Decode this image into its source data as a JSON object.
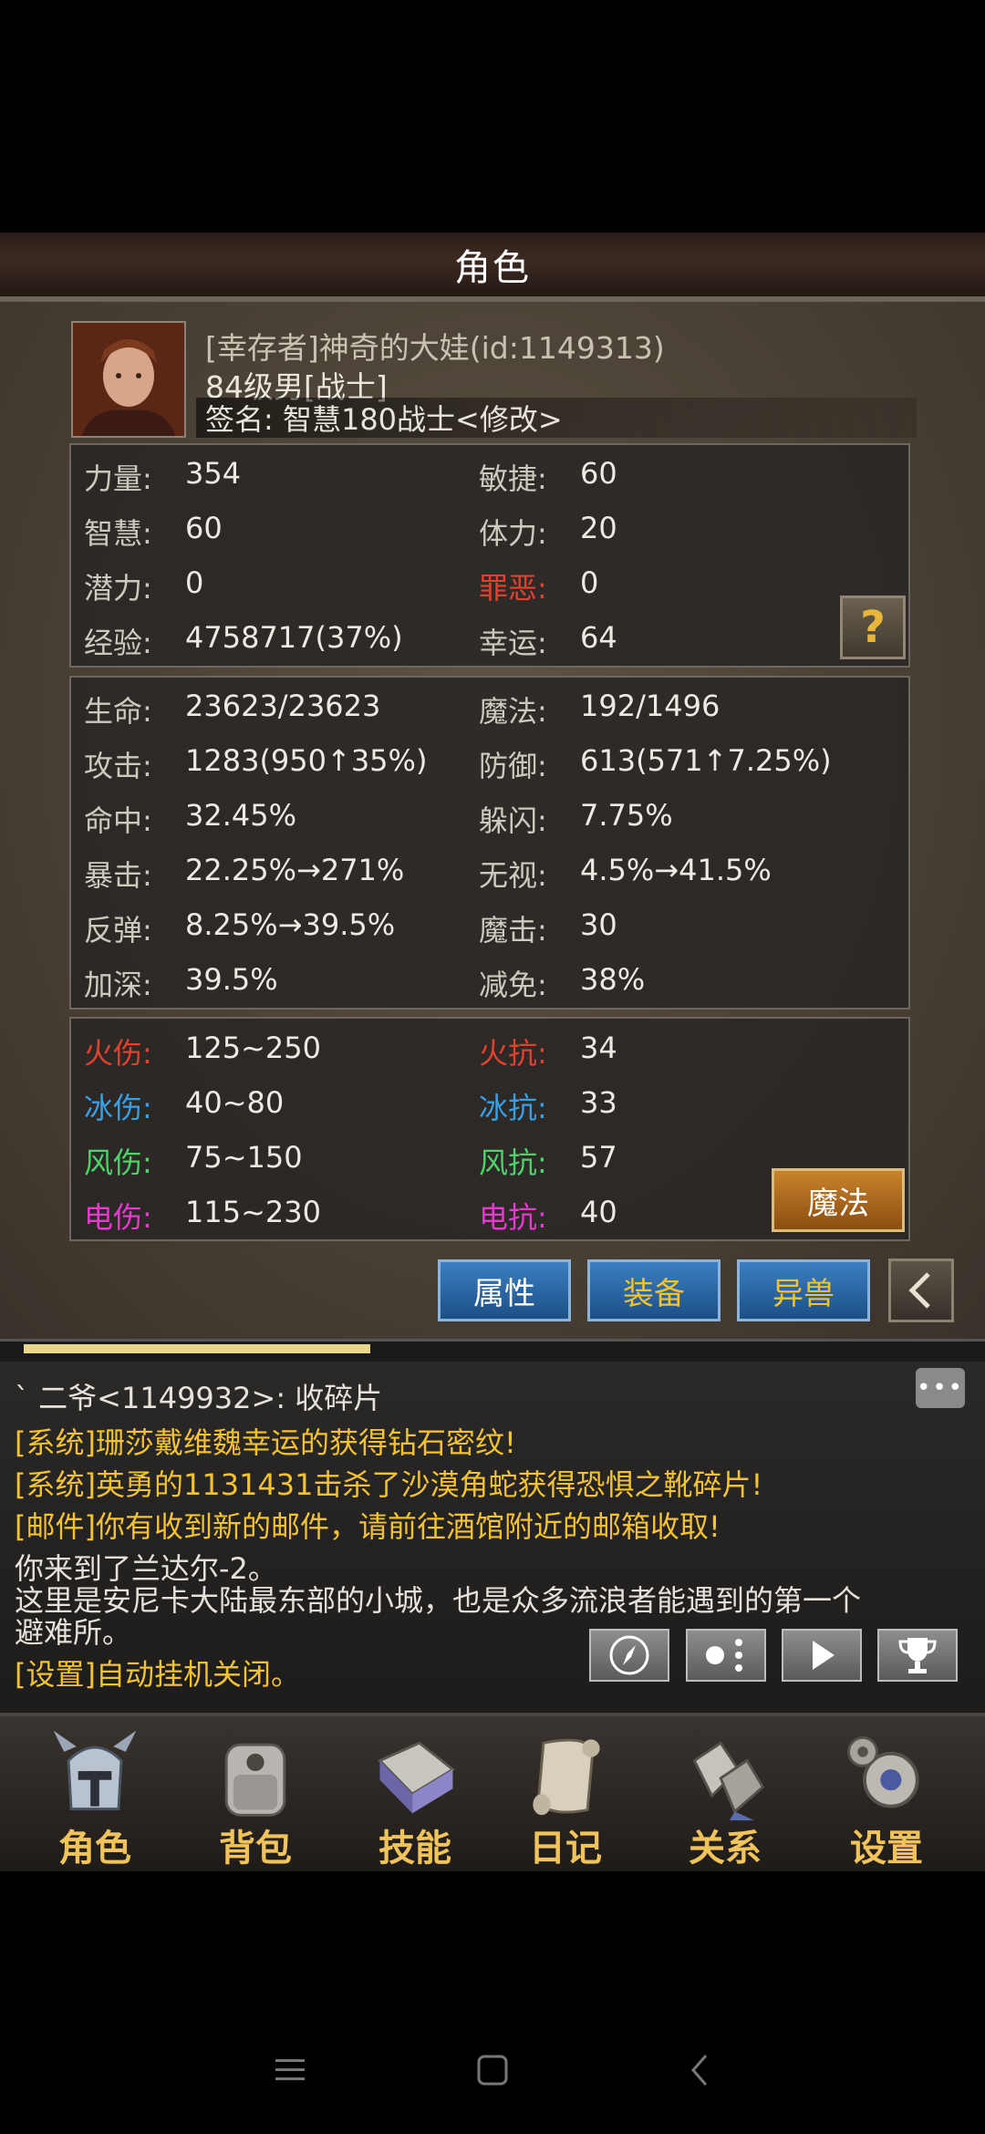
{
  "title": "角色",
  "profile": {
    "name": "[幸存者]神奇的大娃(id:1149313)",
    "level": "84级男[战士]",
    "signature": "签名: 智慧180战士<修改>"
  },
  "base_stats": [
    {
      "label": "力量:",
      "value": "354"
    },
    {
      "label": "敏捷:",
      "value": "60"
    },
    {
      "label": "智慧:",
      "value": "60"
    },
    {
      "label": "体力:",
      "value": "20"
    },
    {
      "label": "潜力:",
      "value": "0"
    },
    {
      "label": "罪恶:",
      "value": "0"
    },
    {
      "label": "经验:",
      "value": "4758717(37%)"
    },
    {
      "label": "幸运:",
      "value": "64"
    }
  ],
  "combat_stats": [
    {
      "label": "生命:",
      "value": "23623/23623"
    },
    {
      "label": "魔法:",
      "value": "192/1496"
    },
    {
      "label": "攻击:",
      "value": "1283(950↑35%)"
    },
    {
      "label": "防御:",
      "value": "613(571↑7.25%)"
    },
    {
      "label": "命中:",
      "value": "32.45%"
    },
    {
      "label": "躲闪:",
      "value": "7.75%"
    },
    {
      "label": "暴击:",
      "value": "22.25%→271%"
    },
    {
      "label": "无视:",
      "value": "4.5%→41.5%"
    },
    {
      "label": "反弹:",
      "value": "8.25%→39.5%"
    },
    {
      "label": "魔击:",
      "value": "30"
    },
    {
      "label": "加深:",
      "value": "39.5%"
    },
    {
      "label": "减免:",
      "value": "38%"
    }
  ],
  "element_stats": [
    {
      "label": "火伤:",
      "value": "125~250"
    },
    {
      "label": "火抗:",
      "value": "34"
    },
    {
      "label": "冰伤:",
      "value": "40~80"
    },
    {
      "label": "冰抗:",
      "value": "33"
    },
    {
      "label": "风伤:",
      "value": "75~150"
    },
    {
      "label": "风抗:",
      "value": "57"
    },
    {
      "label": "电伤:",
      "value": "115~230"
    },
    {
      "label": "电抗:",
      "value": "40"
    }
  ],
  "buttons": {
    "help": "?",
    "magic": "魔法",
    "attributes": "属性",
    "equipment": "装备",
    "beast": "异兽"
  },
  "chat": {
    "lines": [
      "ˋ 二爷<1149932>: 收碎片",
      "[系统]珊莎戴维魏幸运的获得钻石密纹!",
      "[系统]英勇的1131431击杀了沙漠角蛇获得恐惧之靴碎片!",
      "[邮件]你有收到新的邮件，请前往酒馆附近的邮箱收取!",
      "你来到了兰达尔-2。",
      "这里是安尼卡大陆最东部的小城，也是众多流浪者能遇到的第一个",
      "避难所。",
      "[设置]自动挂机关闭。"
    ]
  },
  "nav": [
    "角色",
    "背包",
    "技能",
    "日记",
    "关系",
    "设置"
  ],
  "colors": {
    "gold": "#f2c230",
    "fire": "#e2412f",
    "ice": "#3aa0e6",
    "wind": "#4ed36a",
    "electric": "#e63ad1"
  }
}
